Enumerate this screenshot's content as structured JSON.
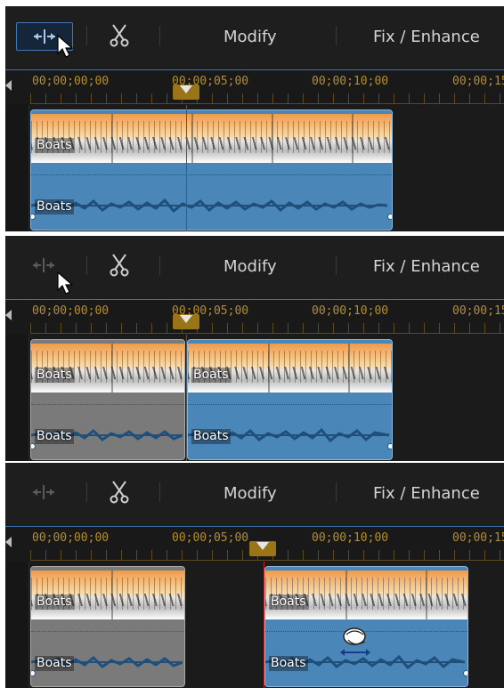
{
  "panels": [
    {
      "toolbar": {
        "split_active": true,
        "modify_label": "Modify",
        "fix_label": "Fix / Enhance"
      },
      "ruler": {
        "timecodes": [
          "00;00;00;00",
          "00;00;05;00",
          "00;00;10;00",
          "00;00;15"
        ]
      },
      "clips": [
        {
          "video_label": "Boats",
          "audio_label": "Boats",
          "state": "selected"
        }
      ]
    },
    {
      "toolbar": {
        "split_active": false,
        "modify_label": "Modify",
        "fix_label": "Fix / Enhance"
      },
      "ruler": {
        "timecodes": [
          "00;00;00;00",
          "00;00;05;00",
          "00;00;10;00",
          "00;00;15"
        ]
      },
      "clips": [
        {
          "video_label": "Boats",
          "audio_label": "Boats",
          "state": "unselected"
        },
        {
          "video_label": "Boats",
          "audio_label": "Boats",
          "state": "selected"
        }
      ]
    },
    {
      "toolbar": {
        "split_active": false,
        "modify_label": "Modify",
        "fix_label": "Fix / Enhance"
      },
      "ruler": {
        "timecodes": [
          "00;00;00;00",
          "00;00;05;00",
          "00;00;10;00",
          "00;00;15"
        ]
      },
      "clips": [
        {
          "video_label": "Boats",
          "audio_label": "Boats",
          "state": "unselected"
        },
        {
          "video_label": "Boats",
          "audio_label": "Boats",
          "state": "selected"
        }
      ]
    }
  ],
  "icons": {
    "split": "split-icon",
    "cut": "scissors-icon",
    "pointer": "mouse-pointer-icon",
    "move": "hand-move-icon"
  },
  "colors": {
    "accent": "#3d78b8",
    "timecode": "#b58e2c",
    "playhead": "#c2272d",
    "clip_selected": "#4a87b8",
    "clip_unselected": "#7a7a7a"
  }
}
